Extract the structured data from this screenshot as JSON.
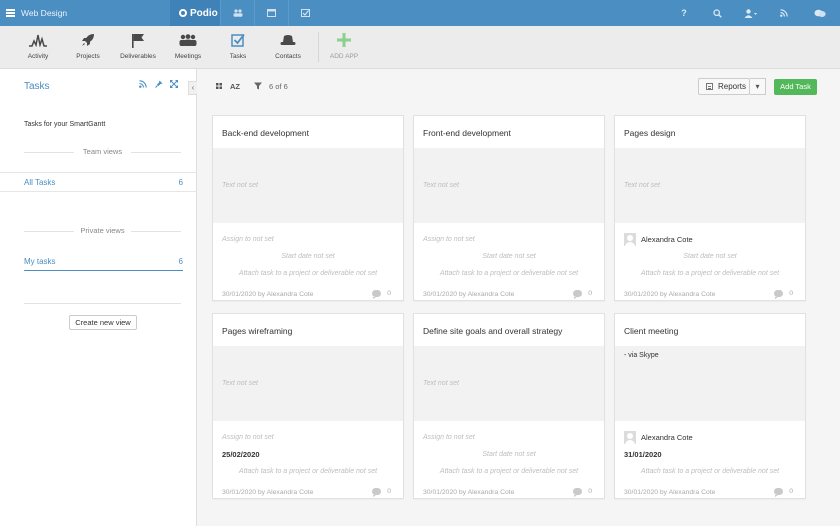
{
  "topbar": {
    "workspace": "Web Design",
    "brand": "Podio",
    "help": "?"
  },
  "apps": [
    {
      "label": "Activity",
      "icon": "activity-icon"
    },
    {
      "label": "Projects",
      "icon": "rocket-icon"
    },
    {
      "label": "Deliverables",
      "icon": "flag-icon"
    },
    {
      "label": "Meetings",
      "icon": "people-icon"
    },
    {
      "label": "Tasks",
      "icon": "checkbox-icon"
    },
    {
      "label": "Contacts",
      "icon": "hat-icon"
    },
    {
      "label": "ADD APP",
      "icon": "plus-icon"
    }
  ],
  "sidebar": {
    "title": "Tasks",
    "subtitle": "Tasks for your SmartGantt",
    "team_header": "Team views",
    "team_views": [
      {
        "label": "All Tasks",
        "count": "6"
      }
    ],
    "private_header": "Private views",
    "private_views": [
      {
        "label": "My tasks",
        "count": "6"
      }
    ],
    "new_view": "Create new view"
  },
  "toolbar": {
    "sort": "AZ",
    "count": "6 of 6",
    "reports": "Reports",
    "more": "▾",
    "add_task": "Add Task"
  },
  "cards": [
    {
      "title": "Back-end development",
      "text": "Text not set",
      "assignee": "Assign to not set",
      "start": "Start date not set",
      "attach": "Attach task to a project or deliverable not set",
      "created": "30/01/2020 by Alexandra Cote",
      "comments": "0"
    },
    {
      "title": "Front-end development",
      "text": "Text not set",
      "assignee": "Assign to not set",
      "start": "Start date not set",
      "attach": "Attach task to a project or deliverable not set",
      "created": "30/01/2020 by Alexandra Cote",
      "comments": "0"
    },
    {
      "title": "Pages design",
      "text": "Text not set",
      "assignee": "Alexandra Cote",
      "start": "Start date not set",
      "attach": "Attach task to a project or deliverable not set",
      "created": "30/01/2020 by Alexandra Cote",
      "comments": "0"
    },
    {
      "title": "Pages wireframing",
      "text": "Text not set",
      "assignee": "Assign to not set",
      "due": "25/02/2020",
      "attach": "Attach task to a project or deliverable not set",
      "created": "30/01/2020 by Alexandra Cote",
      "comments": "0"
    },
    {
      "title": "Define site goals and overall strategy",
      "text": "Text not set",
      "assignee": "Assign to not set",
      "start": "Start date not set",
      "attach": "Attach task to a project or deliverable not set",
      "created": "30/01/2020 by Alexandra Cote",
      "comments": "0"
    },
    {
      "title": "Client meeting",
      "text": "- via Skype",
      "assignee": "Alexandra Cote",
      "due": "31/01/2020",
      "attach": "Attach task to a project or deliverable not set",
      "created": "30/01/2020 by Alexandra Cote",
      "comments": "0"
    }
  ]
}
